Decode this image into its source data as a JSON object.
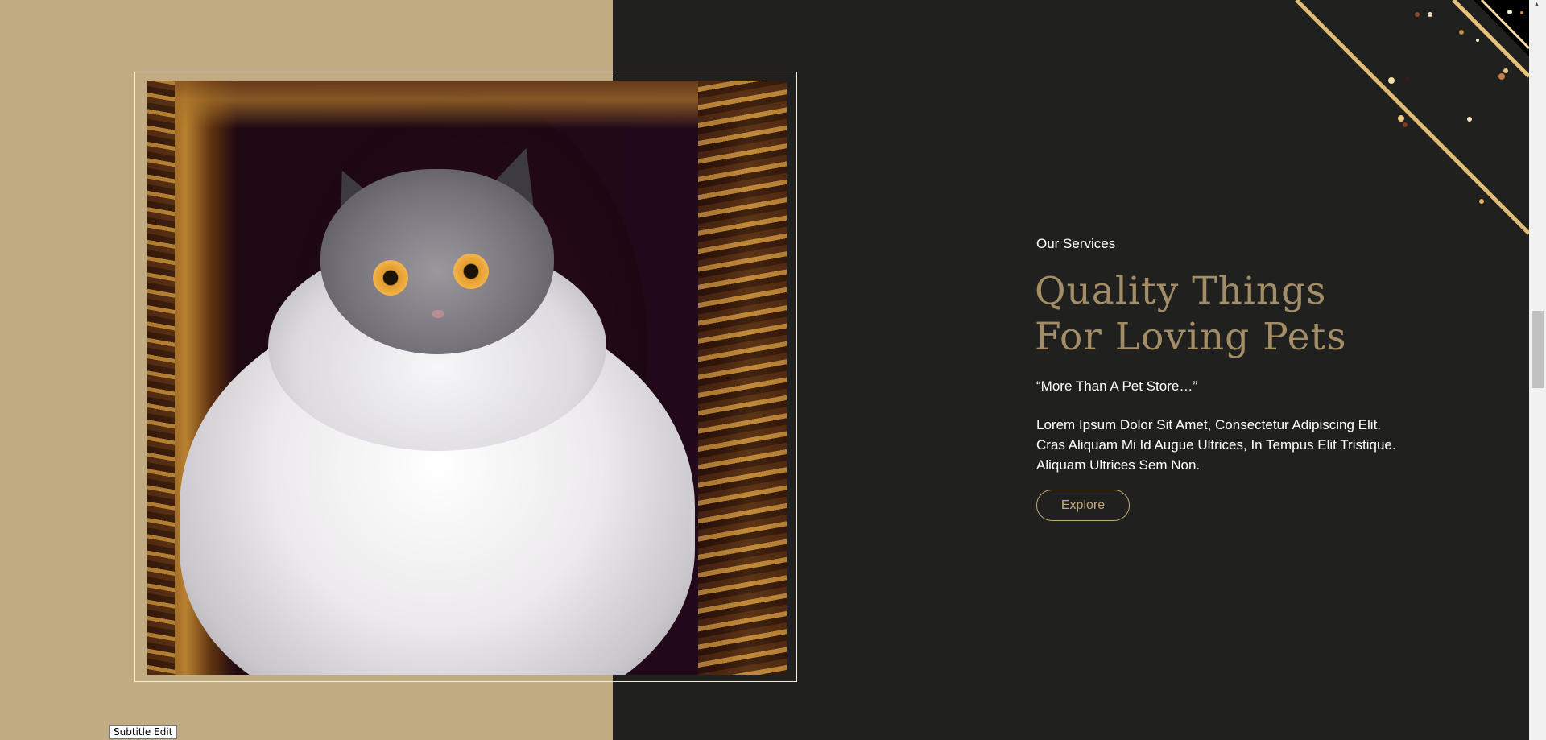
{
  "section": {
    "eyebrow": "Our Services",
    "headline": "Quality Things For Loving Pets",
    "quote": "“More Than A Pet Store…”",
    "body": "Lorem Ipsum Dolor Sit Amet, Consectetur Adipiscing Elit. Cras Aliquam Mi Id Augue Ultrices, In Tempus Elit Tristique. Aliquam Ultrices Sem Non.",
    "explore_label": "Explore"
  },
  "tooltip": {
    "text": "Subtitle Edit"
  },
  "colors": {
    "left_panel": "#c1ab83",
    "right_panel": "#20201e",
    "headline": "#a38d66",
    "button_accent": "#c6aa77"
  },
  "icons": {
    "scroll_up": "scroll-up-arrow-icon"
  }
}
